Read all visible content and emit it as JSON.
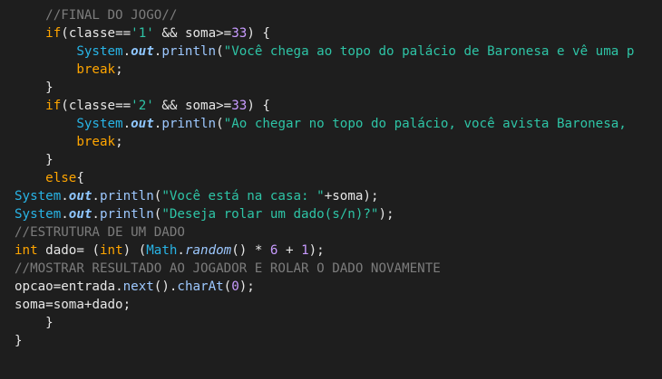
{
  "editor": {
    "lines": [
      {
        "indent": "    ",
        "tokens": [
          {
            "t": "comment",
            "v": "//FINAL DO JOGO//"
          }
        ]
      },
      {
        "indent": "    ",
        "tokens": [
          {
            "t": "keyword",
            "v": "if"
          },
          {
            "t": "punc",
            "v": "("
          },
          {
            "t": "ident",
            "v": "classe"
          },
          {
            "t": "op",
            "v": "=="
          },
          {
            "t": "string",
            "v": "'1'"
          },
          {
            "t": "op",
            "v": " && "
          },
          {
            "t": "ident",
            "v": "soma"
          },
          {
            "t": "op",
            "v": ">="
          },
          {
            "t": "number",
            "v": "33"
          },
          {
            "t": "punc",
            "v": ") {"
          }
        ]
      },
      {
        "indent": "        ",
        "tokens": [
          {
            "t": "class",
            "v": "System"
          },
          {
            "t": "punc",
            "v": "."
          },
          {
            "t": "field",
            "v": "out"
          },
          {
            "t": "punc",
            "v": "."
          },
          {
            "t": "method",
            "v": "println"
          },
          {
            "t": "punc",
            "v": "("
          },
          {
            "t": "string",
            "v": "\"Você chega ao topo do palácio de Baronesa e vê uma p"
          }
        ]
      },
      {
        "indent": "        ",
        "tokens": [
          {
            "t": "keyword",
            "v": "break"
          },
          {
            "t": "punc",
            "v": ";"
          }
        ]
      },
      {
        "indent": "    ",
        "tokens": [
          {
            "t": "punc",
            "v": "}"
          }
        ]
      },
      {
        "indent": "    ",
        "tokens": [
          {
            "t": "keyword",
            "v": "if"
          },
          {
            "t": "punc",
            "v": "("
          },
          {
            "t": "ident",
            "v": "classe"
          },
          {
            "t": "op",
            "v": "=="
          },
          {
            "t": "string",
            "v": "'2'"
          },
          {
            "t": "op",
            "v": " && "
          },
          {
            "t": "ident",
            "v": "soma"
          },
          {
            "t": "op",
            "v": ">="
          },
          {
            "t": "number",
            "v": "33"
          },
          {
            "t": "punc",
            "v": ") {"
          }
        ]
      },
      {
        "indent": "        ",
        "tokens": [
          {
            "t": "class",
            "v": "System"
          },
          {
            "t": "punc",
            "v": "."
          },
          {
            "t": "field",
            "v": "out"
          },
          {
            "t": "punc",
            "v": "."
          },
          {
            "t": "method",
            "v": "println"
          },
          {
            "t": "punc",
            "v": "("
          },
          {
            "t": "string",
            "v": "\"Ao chegar no topo do palácio, você avista Baronesa,"
          }
        ]
      },
      {
        "indent": "        ",
        "tokens": [
          {
            "t": "keyword",
            "v": "break"
          },
          {
            "t": "punc",
            "v": ";"
          }
        ]
      },
      {
        "indent": "    ",
        "tokens": [
          {
            "t": "punc",
            "v": "}"
          }
        ]
      },
      {
        "indent": "    ",
        "tokens": [
          {
            "t": "keyword",
            "v": "else"
          },
          {
            "t": "punc",
            "v": "{"
          }
        ]
      },
      {
        "indent": "",
        "tokens": [
          {
            "t": "class",
            "v": "System"
          },
          {
            "t": "punc",
            "v": "."
          },
          {
            "t": "field",
            "v": "out"
          },
          {
            "t": "punc",
            "v": "."
          },
          {
            "t": "method",
            "v": "println"
          },
          {
            "t": "punc",
            "v": "("
          },
          {
            "t": "string",
            "v": "\"Você está na casa: \""
          },
          {
            "t": "op",
            "v": "+"
          },
          {
            "t": "ident",
            "v": "soma"
          },
          {
            "t": "punc",
            "v": ");"
          }
        ]
      },
      {
        "indent": "",
        "tokens": [
          {
            "t": "class",
            "v": "System"
          },
          {
            "t": "punc",
            "v": "."
          },
          {
            "t": "field",
            "v": "out"
          },
          {
            "t": "punc",
            "v": "."
          },
          {
            "t": "method",
            "v": "println"
          },
          {
            "t": "punc",
            "v": "("
          },
          {
            "t": "string",
            "v": "\"Deseja rolar um dado(s/n)?\""
          },
          {
            "t": "punc",
            "v": ");"
          }
        ]
      },
      {
        "indent": "",
        "tokens": [
          {
            "t": "comment",
            "v": "//ESTRUTURA DE UM DADO"
          }
        ]
      },
      {
        "indent": "",
        "tokens": [
          {
            "t": "keyword",
            "v": "int"
          },
          {
            "t": "ident",
            "v": " dado"
          },
          {
            "t": "op",
            "v": "= "
          },
          {
            "t": "punc",
            "v": "("
          },
          {
            "t": "keyword",
            "v": "int"
          },
          {
            "t": "punc",
            "v": ") ("
          },
          {
            "t": "class",
            "v": "Math"
          },
          {
            "t": "punc",
            "v": "."
          },
          {
            "t": "italicm",
            "v": "random"
          },
          {
            "t": "punc",
            "v": "()"
          },
          {
            "t": "op",
            "v": " * "
          },
          {
            "t": "number",
            "v": "6"
          },
          {
            "t": "op",
            "v": " + "
          },
          {
            "t": "number",
            "v": "1"
          },
          {
            "t": "punc",
            "v": ");"
          }
        ]
      },
      {
        "indent": "",
        "tokens": [
          {
            "t": "comment",
            "v": "//MOSTRAR RESULTADO AO JOGADOR E ROLAR O DADO NOVAMENTE"
          }
        ]
      },
      {
        "indent": "",
        "tokens": [
          {
            "t": "ident",
            "v": "opcao"
          },
          {
            "t": "op",
            "v": "="
          },
          {
            "t": "ident",
            "v": "entrada"
          },
          {
            "t": "punc",
            "v": "."
          },
          {
            "t": "method",
            "v": "next"
          },
          {
            "t": "punc",
            "v": "()."
          },
          {
            "t": "method",
            "v": "charAt"
          },
          {
            "t": "punc",
            "v": "("
          },
          {
            "t": "number",
            "v": "0"
          },
          {
            "t": "punc",
            "v": ");"
          }
        ]
      },
      {
        "indent": "",
        "tokens": [
          {
            "t": "ident",
            "v": "soma"
          },
          {
            "t": "op",
            "v": "="
          },
          {
            "t": "ident",
            "v": "soma"
          },
          {
            "t": "op",
            "v": "+"
          },
          {
            "t": "ident",
            "v": "dado"
          },
          {
            "t": "punc",
            "v": ";"
          }
        ]
      },
      {
        "indent": "    ",
        "tokens": [
          {
            "t": "punc",
            "v": "}"
          }
        ]
      },
      {
        "indent": "",
        "tokens": [
          {
            "t": "punc",
            "v": "}"
          }
        ]
      }
    ]
  }
}
